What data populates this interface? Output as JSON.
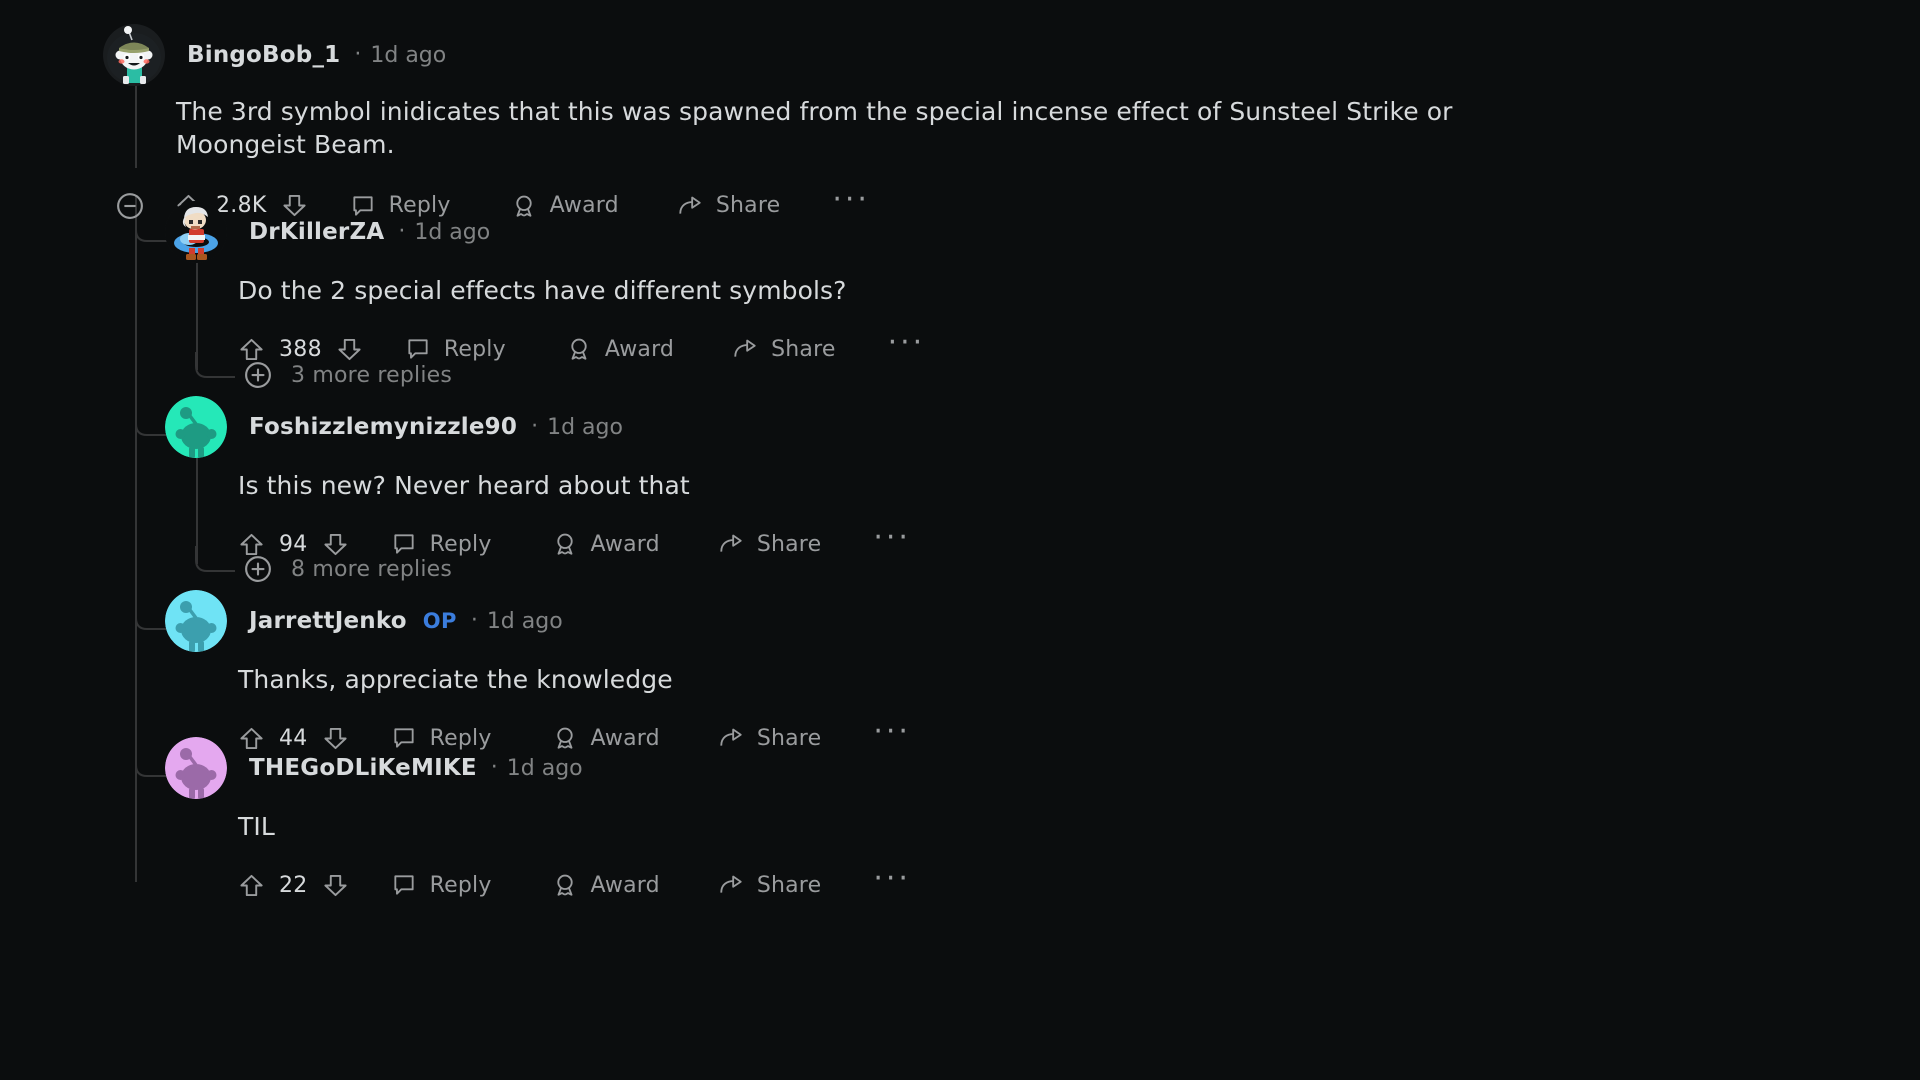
{
  "theme": {
    "background": "#0b0d0e",
    "text_primary": "#d7dadc",
    "text_muted": "#818384",
    "thread_line": "#343536",
    "op_badge_color": "#3b7ddd"
  },
  "actions_labels": {
    "reply": "Reply",
    "award": "Award",
    "share": "Share",
    "more": "···"
  },
  "comments": [
    {
      "id": "bingobob",
      "username": "BingoBob_1",
      "op": false,
      "separator": "·",
      "timestamp": "1d ago",
      "body": "The 3rd symbol inidicates that this was spawned from the special incense effect of Sunsteel Strike or Moongeist Beam.",
      "votes": "2.8K",
      "avatar_name": "avatar-snoo-beanie",
      "collapse_icon": "minus-circle-icon",
      "upvote_icon": "upvote-arrow-icon",
      "downvote_icon": "downvote-arrow-icon",
      "reply_icon": "comment-bubble-icon",
      "award_icon": "award-badge-icon",
      "share_icon": "share-arrow-icon"
    },
    {
      "id": "drkillerza",
      "username": "DrKillerZA",
      "op": false,
      "separator": "·",
      "timestamp": "1d ago",
      "body": "Do the 2 special effects have different symbols?",
      "votes": "388",
      "avatar_name": "avatar-pixel-swimmer",
      "more_replies": "3 more replies",
      "more_replies_icon": "plus-circle-icon"
    },
    {
      "id": "foshizzle",
      "username": "Foshizzlemynizzle90",
      "op": false,
      "separator": "·",
      "timestamp": "1d ago",
      "body": "Is this new? Never heard about that",
      "votes": "94",
      "avatar_name": "avatar-snoo-teal",
      "more_replies": "8 more replies",
      "more_replies_icon": "plus-circle-icon"
    },
    {
      "id": "jarrettjenko",
      "username": "JarrettJenko",
      "op": true,
      "op_label": "OP",
      "separator": "·",
      "timestamp": "1d ago",
      "body": "Thanks, appreciate the knowledge",
      "votes": "44",
      "avatar_name": "avatar-snoo-cyan"
    },
    {
      "id": "thegodlikemike",
      "username": "THEGoDLiKeMIKE",
      "op": false,
      "separator": "·",
      "timestamp": "1d ago",
      "body": "TIL",
      "votes": "22",
      "avatar_name": "avatar-snoo-orchid"
    }
  ]
}
